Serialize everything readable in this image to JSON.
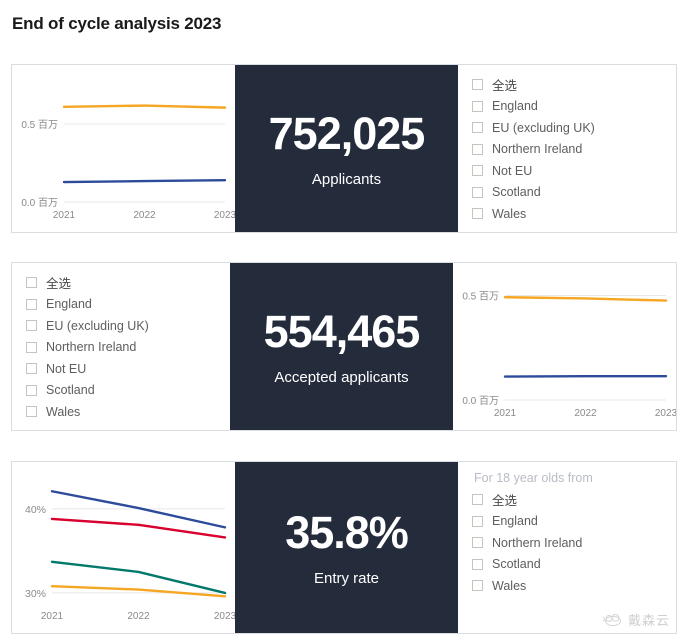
{
  "page": {
    "title": "End of cycle analysis 2023",
    "background": "#ffffff"
  },
  "theme": {
    "kpi_panel_bg": "#242c3c",
    "kpi_text": "#ffffff",
    "card_border": "#d9dce1",
    "axis_text": "#8a8a8a",
    "gridline": "#e8e8e8",
    "checkbox_border": "#c8c3bb",
    "series_orange": "#f5a623",
    "series_blue": "#2e4b9b",
    "series_red": "#d8002e",
    "series_teal": "#00796b"
  },
  "watermark": {
    "text": "戴森云",
    "icon": "cloud-icon"
  },
  "cards": [
    {
      "id": "applicants",
      "layout": "chart-kpi-filter",
      "kpi": {
        "value": "752,025",
        "label": "Applicants"
      },
      "filter": {
        "heading": "",
        "options": [
          {
            "label": "全选",
            "checked": false
          },
          {
            "label": "England",
            "checked": false
          },
          {
            "label": "EU (excluding UK)",
            "checked": false
          },
          {
            "label": "Northern Ireland",
            "checked": false
          },
          {
            "label": "Not EU",
            "checked": false
          },
          {
            "label": "Scotland",
            "checked": false
          },
          {
            "label": "Wales",
            "checked": false
          }
        ]
      },
      "chart_key": 0
    },
    {
      "id": "accepted-applicants",
      "layout": "filter-kpi-chart",
      "kpi": {
        "value": "554,465",
        "label": "Accepted applicants"
      },
      "filter": {
        "heading": "",
        "options": [
          {
            "label": "全选",
            "checked": false
          },
          {
            "label": "England",
            "checked": false
          },
          {
            "label": "EU (excluding UK)",
            "checked": false
          },
          {
            "label": "Northern Ireland",
            "checked": false
          },
          {
            "label": "Not EU",
            "checked": false
          },
          {
            "label": "Scotland",
            "checked": false
          },
          {
            "label": "Wales",
            "checked": false
          }
        ]
      },
      "chart_key": 1
    },
    {
      "id": "entry-rate",
      "layout": "chart-kpi-filter",
      "kpi": {
        "value": "35.8%",
        "label": "Entry rate"
      },
      "filter": {
        "heading": "For 18 year olds from",
        "options": [
          {
            "label": "全选",
            "checked": false
          },
          {
            "label": "England",
            "checked": false
          },
          {
            "label": "Northern Ireland",
            "checked": false
          },
          {
            "label": "Scotland",
            "checked": false
          },
          {
            "label": "Wales",
            "checked": false
          }
        ]
      },
      "chart_key": 2
    }
  ],
  "chart_data": [
    {
      "type": "line",
      "title": "Applicants trend",
      "xlabel": "",
      "ylabel": "",
      "x": [
        "2021",
        "2022",
        "2023"
      ],
      "ytick_labels": [
        "0.0 百万",
        "0.5 百万"
      ],
      "yticks": [
        0.0,
        0.5
      ],
      "ylim": [
        0.0,
        0.75
      ],
      "grid": true,
      "legend": "none",
      "series": [
        {
          "name": "England",
          "color": "#f5a623",
          "values": [
            0.61,
            0.618,
            0.605
          ]
        },
        {
          "name": "Not EU",
          "color": "#2e4b9b",
          "values": [
            0.128,
            0.134,
            0.14
          ]
        }
      ]
    },
    {
      "type": "line",
      "title": "Accepted applicants trend",
      "xlabel": "",
      "ylabel": "",
      "x": [
        "2021",
        "2022",
        "2023"
      ],
      "ytick_labels": [
        "0.0 百万",
        "0.5 百万"
      ],
      "yticks": [
        0.0,
        0.5
      ],
      "ylim": [
        0.0,
        0.56
      ],
      "grid": true,
      "legend": "none",
      "series": [
        {
          "name": "England",
          "color": "#f5a623",
          "values": [
            0.492,
            0.486,
            0.476
          ]
        },
        {
          "name": "Not EU",
          "color": "#2e4b9b",
          "values": [
            0.112,
            0.114,
            0.114
          ]
        }
      ]
    },
    {
      "type": "line",
      "title": "Entry rate trend",
      "xlabel": "",
      "ylabel": "",
      "x": [
        "2021",
        "2022",
        "2023"
      ],
      "ytick_labels": [
        "30%",
        "40%"
      ],
      "yticks": [
        30,
        40
      ],
      "ylim": [
        28.8,
        43.2
      ],
      "grid": true,
      "legend": "none",
      "series": [
        {
          "name": "Northern Ireland",
          "color": "#2e4b9b",
          "values": [
            42.1,
            40.1,
            37.8
          ]
        },
        {
          "name": "England",
          "color": "#d8002e",
          "values": [
            38.8,
            38.1,
            36.6
          ]
        },
        {
          "name": "Scotland",
          "color": "#00796b",
          "values": [
            33.7,
            32.5,
            30.0
          ]
        },
        {
          "name": "Wales",
          "color": "#f5a623",
          "values": [
            30.8,
            30.4,
            29.6
          ]
        }
      ]
    }
  ]
}
